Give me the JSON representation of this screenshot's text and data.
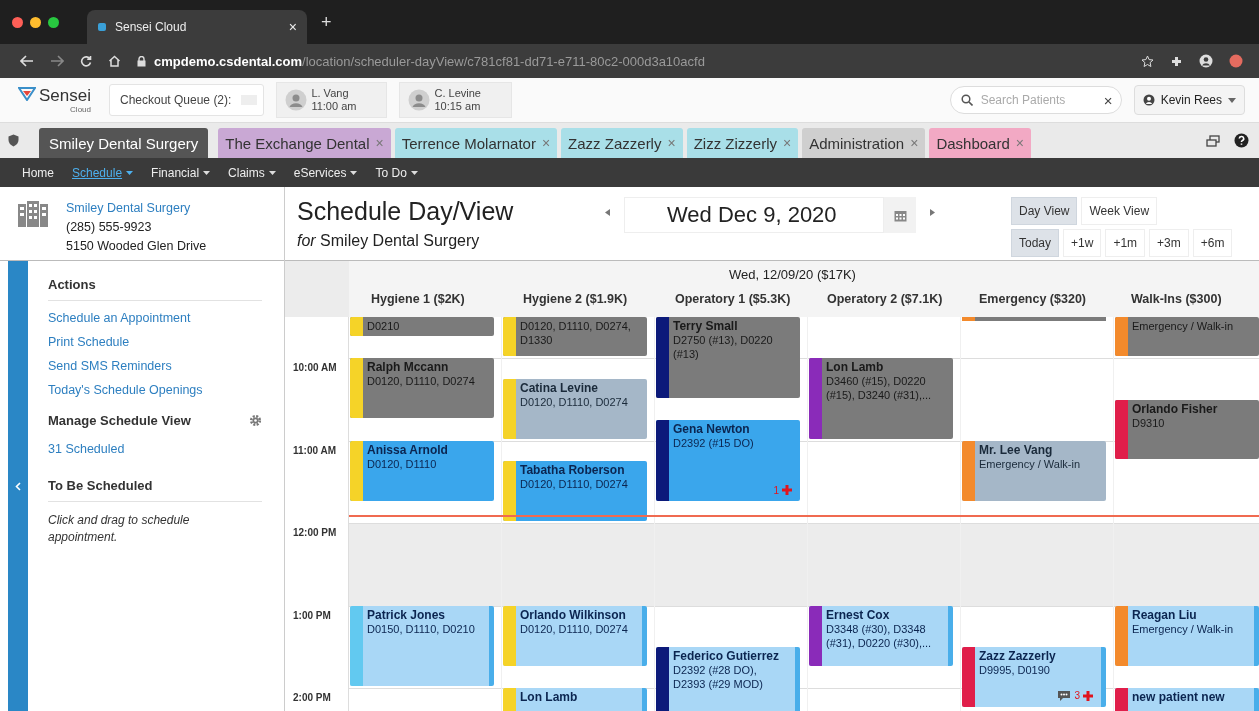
{
  "browser": {
    "tab_title": "Sensei Cloud",
    "tab_close": "×",
    "new_tab": "+",
    "url_domain": "cmpdemo.csdental.com",
    "url_path": "/location/scheduler-dayView/c781cf81-dd71-e711-80c2-000d3a10acfd"
  },
  "header": {
    "logo": "Sensei",
    "logo_sub": "Cloud",
    "checkout_queue": "Checkout Queue (2):",
    "chips": [
      {
        "name": "L. Vang",
        "time": "11:00 am"
      },
      {
        "name": "C. Levine",
        "time": "10:15 am"
      }
    ],
    "search": {
      "placeholder": "Search Patients",
      "clear": "×"
    },
    "user": "Kevin Rees"
  },
  "tabs": [
    {
      "label": "Smiley Dental Surgery",
      "selected": true,
      "color": "#555555"
    },
    {
      "label": "The Exchange Dental",
      "close": "×",
      "selected": false,
      "color": "#c9a8d4"
    },
    {
      "label": "Terrence Molarnator",
      "close": "×",
      "selected": false,
      "color": "#a9dfe8"
    },
    {
      "label": "Zazz Zazzerly",
      "close": "×",
      "selected": false,
      "color": "#a9dfe8"
    },
    {
      "label": "Zizz Zizzerly",
      "close": "×",
      "selected": false,
      "color": "#a9dfe8"
    },
    {
      "label": "Administration",
      "close": "×",
      "selected": false,
      "color": "#cfcfcf"
    },
    {
      "label": "Dashboard",
      "close": "×",
      "selected": false,
      "color": "#f2a9c4"
    }
  ],
  "nav": [
    {
      "label": "Home",
      "selected": false,
      "dropdown": false
    },
    {
      "label": "Schedule",
      "selected": true,
      "dropdown": true
    },
    {
      "label": "Financial",
      "selected": false,
      "dropdown": true
    },
    {
      "label": "Claims",
      "selected": false,
      "dropdown": true
    },
    {
      "label": "eServices",
      "selected": false,
      "dropdown": true
    },
    {
      "label": "To Do",
      "selected": false,
      "dropdown": true
    }
  ],
  "location": {
    "name": "Smiley Dental Surgery",
    "phone": "(285) 555-9923",
    "address": "5150 Wooded Glen Drive"
  },
  "sidebar": {
    "actions_heading": "Actions",
    "actions": [
      "Schedule an Appointment",
      "Print Schedule",
      "Send SMS Reminders",
      "Today's Schedule Openings"
    ],
    "manage": "Manage Schedule View",
    "scheduled": "31 Scheduled",
    "to_be_heading": "To Be Scheduled",
    "hint": "Click and drag to schedule appointment."
  },
  "schedule": {
    "title": "Schedule Day/View",
    "subtitle": "*for* Smiley Dental Surgery",
    "date": "Wed Dec 9, 2020",
    "views": [
      {
        "label": "Day View",
        "selected": true
      },
      {
        "label": "Week View",
        "selected": false
      }
    ],
    "jumps": [
      {
        "label": "Today",
        "selected": true
      },
      {
        "label": "+1w",
        "selected": false
      },
      {
        "label": "+1m",
        "selected": false
      },
      {
        "label": "+3m",
        "selected": false
      },
      {
        "label": "+6m",
        "selected": false
      }
    ],
    "day_label": "Wed, 12/09/20 ($17K)",
    "times": [
      {
        "label": "10:00 AM",
        "lunch": false,
        "now": false
      },
      {
        "label": "11:00 AM",
        "lunch": false,
        "now": true
      },
      {
        "label": "12:00 PM",
        "lunch": true,
        "now": false
      },
      {
        "label": "1:00 PM",
        "lunch": false,
        "now": false
      },
      {
        "label": "2:00 PM",
        "lunch": false,
        "now": false
      }
    ],
    "columns": [
      {
        "name": "Hygiene 1 ($2K)",
        "slots": [
          {
            "kind": "gray",
            "codes": "D0210",
            "color": "#f5d328"
          },
          {
            "kind": "free"
          },
          {
            "kind": "gray",
            "name": "Ralph Mccann",
            "codes": "D0120, D1110, D0274",
            "color": "#f5d328"
          },
          {
            "kind": "continued"
          },
          {
            "kind": "continued"
          },
          {
            "kind": "free"
          },
          {
            "kind": "blue",
            "name": "Anissa Arnold",
            "codes": "D0120, D1110",
            "color": "#f5d328"
          },
          {
            "kind": "continued"
          },
          {
            "kind": "continued"
          },
          {
            "kind": "free"
          },
          {
            "kind": "free"
          },
          {
            "kind": "free"
          },
          {
            "kind": "free"
          },
          {
            "kind": "free"
          },
          {
            "kind": "light",
            "name": "Patrick Jones",
            "codes": "D0150, D1110, D0210",
            "color": "#62c9f0"
          },
          {
            "kind": "continued"
          },
          {
            "kind": "continued"
          },
          {
            "kind": "continued"
          },
          {
            "kind": "free"
          },
          {
            "kind": "free"
          }
        ]
      },
      {
        "name": "Hygiene 2 ($1.9K)",
        "slots": [
          {
            "kind": "gray",
            "codes": "D0120, D1110, D0274, D1330",
            "color": "#f5d328"
          },
          {
            "kind": "continued"
          },
          {
            "kind": "free"
          },
          {
            "kind": "slate",
            "name": "Catina Levine",
            "codes": "D0120, D1110, D0274",
            "color": "#f5d328"
          },
          {
            "kind": "continued"
          },
          {
            "kind": "continued"
          },
          {
            "kind": "free"
          },
          {
            "kind": "blue",
            "name": "Tabatha Roberson",
            "codes": "D0120, D1110, D0274",
            "color": "#f5d328"
          },
          {
            "kind": "continued"
          },
          {
            "kind": "continued"
          },
          {
            "kind": "free"
          },
          {
            "kind": "free"
          },
          {
            "kind": "free"
          },
          {
            "kind": "free"
          },
          {
            "kind": "light",
            "name": "Orlando Wilkinson",
            "codes": "D0120, D1110, D0274",
            "color": "#f5d328"
          },
          {
            "kind": "continued"
          },
          {
            "kind": "continued"
          },
          {
            "kind": "free"
          },
          {
            "kind": "light",
            "name": "Lon Lamb",
            "color": "#f5d328"
          },
          {
            "kind": "continued"
          }
        ]
      },
      {
        "name": "Operatory 1 ($5.3K)",
        "slots": [
          {
            "kind": "gray",
            "name": "Terry Small",
            "codes": "D2750 (#13), D0220 (#13)",
            "color": "#0c1a7a"
          },
          {
            "kind": "continued"
          },
          {
            "kind": "continued"
          },
          {
            "kind": "continued"
          },
          {
            "kind": "free"
          },
          {
            "kind": "blue",
            "name": "Gena Newton",
            "codes": "D2392 (#15 DO)",
            "color": "#0c1a7a",
            "alerts": "1"
          },
          {
            "kind": "continued"
          },
          {
            "kind": "continued"
          },
          {
            "kind": "continued"
          },
          {
            "kind": "free"
          },
          {
            "kind": "free"
          },
          {
            "kind": "free"
          },
          {
            "kind": "free"
          },
          {
            "kind": "free"
          },
          {
            "kind": "free"
          },
          {
            "kind": "free"
          },
          {
            "kind": "light",
            "name": "Federico Gutierrez",
            "codes": "D2392 (#28 DO), D2393 (#29 MOD)",
            "color": "#0c1a7a"
          },
          {
            "kind": "continued"
          },
          {
            "kind": "continued"
          },
          {
            "kind": "continued"
          }
        ]
      },
      {
        "name": "Operatory 2 ($7.1K)",
        "slots": [
          {
            "kind": "free"
          },
          {
            "kind": "free"
          },
          {
            "kind": "gray",
            "name": "Lon Lamb",
            "codes": "D3460 (#15), D0220 (#15), D3240 (#31),...",
            "color": "#8a2bb9"
          },
          {
            "kind": "continued"
          },
          {
            "kind": "continued"
          },
          {
            "kind": "continued"
          },
          {
            "kind": "free"
          },
          {
            "kind": "free"
          },
          {
            "kind": "free"
          },
          {
            "kind": "free"
          },
          {
            "kind": "free"
          },
          {
            "kind": "free"
          },
          {
            "kind": "free"
          },
          {
            "kind": "free"
          },
          {
            "kind": "light",
            "name": "Ernest Cox",
            "codes": "D3348 (#30), D3348 (#31), D0220 (#30),...",
            "color": "#8a2bb9"
          },
          {
            "kind": "continued"
          },
          {
            "kind": "continued"
          },
          {
            "kind": "free"
          },
          {
            "kind": "free"
          },
          {
            "kind": "free"
          }
        ]
      },
      {
        "name": "Emergency ($320)",
        "slots": [
          {
            "kind": "sliver",
            "color": "#f38a2c"
          },
          {
            "kind": "free"
          },
          {
            "kind": "free"
          },
          {
            "kind": "free"
          },
          {
            "kind": "free"
          },
          {
            "kind": "free"
          },
          {
            "kind": "slate",
            "name": "Mr. Lee Vang",
            "codes": "Emergency / Walk-in",
            "color": "#f38a2c"
          },
          {
            "kind": "continued"
          },
          {
            "kind": "continued"
          },
          {
            "kind": "free"
          },
          {
            "kind": "free"
          },
          {
            "kind": "free"
          },
          {
            "kind": "free"
          },
          {
            "kind": "free"
          },
          {
            "kind": "free"
          },
          {
            "kind": "free"
          },
          {
            "kind": "light",
            "name": "Zazz Zazzerly",
            "codes": "D9995, D0190",
            "color": "#e01e4a",
            "note": true,
            "alerts": "3"
          },
          {
            "kind": "continued"
          },
          {
            "kind": "continued"
          },
          {
            "kind": "free"
          }
        ]
      },
      {
        "name": "Walk-Ins ($300)",
        "slots": [
          {
            "kind": "gray",
            "codes": "Emergency / Walk-in",
            "color": "#f38a2c"
          },
          {
            "kind": "continued"
          },
          {
            "kind": "free"
          },
          {
            "kind": "free"
          },
          {
            "kind": "gray",
            "name": "Orlando Fisher",
            "codes": "D9310",
            "color": "#e01e4a"
          },
          {
            "kind": "continued"
          },
          {
            "kind": "continued"
          },
          {
            "kind": "free"
          },
          {
            "kind": "free"
          },
          {
            "kind": "free"
          },
          {
            "kind": "free"
          },
          {
            "kind": "free"
          },
          {
            "kind": "free"
          },
          {
            "kind": "free"
          },
          {
            "kind": "light",
            "name": "Reagan Liu",
            "codes": "Emergency / Walk-in",
            "color": "#f38a2c"
          },
          {
            "kind": "continued"
          },
          {
            "kind": "continued"
          },
          {
            "kind": "free"
          },
          {
            "kind": "light",
            "name": "new patient new",
            "color": "#e01e4a"
          },
          {
            "kind": "continued"
          }
        ]
      }
    ]
  }
}
